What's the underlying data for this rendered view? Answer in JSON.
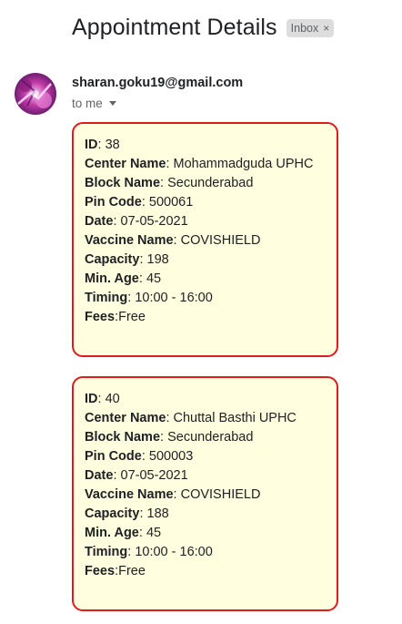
{
  "email": {
    "subject": "Appointment Details",
    "label": "Inbox",
    "label_close": "×",
    "sender": "sharan.goku19@gmail.com",
    "recipient": "to me"
  },
  "icons": {
    "avatar": "sender-avatar-image",
    "label_close": "close-icon",
    "recipient_toggle": "chevron-down-icon"
  },
  "colors": {
    "card_border": "#dd1c1c",
    "card_background": "#ffffe0",
    "label_chip": "#dddddd"
  },
  "appointments": [
    {
      "id_label": "ID",
      "id_sep": ": ",
      "id": "38",
      "center_label": "Center Name",
      "center_sep": ": ",
      "center": "Mohammadguda UPHC",
      "block_label": "Block Name",
      "block_sep": ": ",
      "block": "Secunderabad",
      "pin_label": "Pin Code",
      "pin_sep": ": ",
      "pin": "500061",
      "date_label": "Date",
      "date_sep": ": ",
      "date": "07-05-2021",
      "vaccine_label": "Vaccine Name",
      "vaccine_sep": ": ",
      "vaccine": "COVISHIELD",
      "capacity_label": "Capacity",
      "capacity_sep": ": ",
      "capacity": "198",
      "age_label": "Min. Age",
      "age_sep": ": ",
      "age": "45",
      "timing_label": "Timing",
      "timing_sep": ": ",
      "timing": "10:00 - 16:00",
      "fees_label": "Fees",
      "fees_sep": ":",
      "fees": "Free"
    },
    {
      "id_label": "ID",
      "id_sep": ": ",
      "id": "40",
      "center_label": "Center Name",
      "center_sep": ": ",
      "center": "Chuttal Basthi UPHC",
      "block_label": "Block Name",
      "block_sep": ": ",
      "block": "Secunderabad",
      "pin_label": "Pin Code",
      "pin_sep": ": ",
      "pin": "500003",
      "date_label": "Date",
      "date_sep": ": ",
      "date": "07-05-2021",
      "vaccine_label": "Vaccine Name",
      "vaccine_sep": ": ",
      "vaccine": "COVISHIELD",
      "capacity_label": "Capacity",
      "capacity_sep": ": ",
      "capacity": "188",
      "age_label": "Min. Age",
      "age_sep": ": ",
      "age": "45",
      "timing_label": "Timing",
      "timing_sep": ": ",
      "timing": "10:00 - 16:00",
      "fees_label": "Fees",
      "fees_sep": ":",
      "fees": "Free"
    }
  ]
}
